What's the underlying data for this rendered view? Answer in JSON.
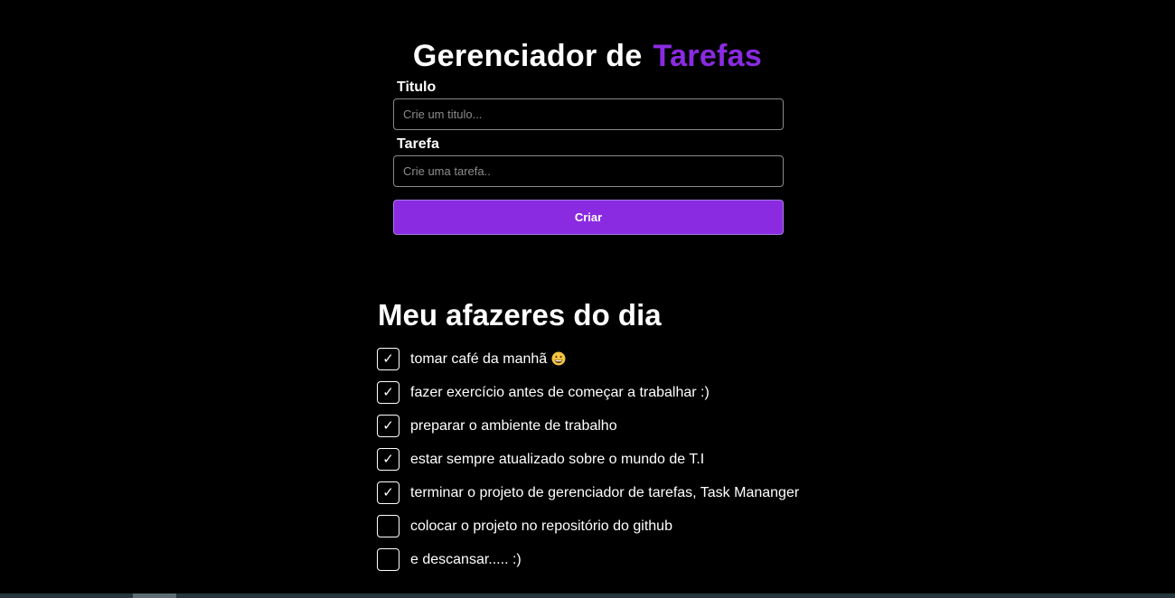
{
  "header": {
    "title_part1": "Gerenciador de",
    "title_part2": "Tarefas"
  },
  "form": {
    "title_label": "Titulo",
    "title_placeholder": "Crie um titulo...",
    "title_value": "",
    "task_label": "Tarefa",
    "task_placeholder": "Crie uma tarefa..",
    "task_value": "",
    "create_button_label": "Criar"
  },
  "tasks": {
    "heading": "Meu afazeres do dia",
    "items": [
      {
        "text": "tomar café da manhã",
        "checked": true,
        "emoji": "grinning-face-icon"
      },
      {
        "text": "fazer exercício antes de começar a trabalhar :)",
        "checked": true
      },
      {
        "text": "preparar o ambiente de trabalho",
        "checked": true
      },
      {
        "text": "estar sempre atualizado sobre o mundo de T.I",
        "checked": true
      },
      {
        "text": "terminar o projeto de gerenciador de tarefas, Task Mananger",
        "checked": true
      },
      {
        "text": "colocar o projeto no repositório do github",
        "checked": false
      },
      {
        "text": "e descansar..... :)",
        "checked": false
      }
    ]
  },
  "colors": {
    "background": "#000000",
    "accent": "#8a2be2",
    "text": "#ffffff"
  }
}
